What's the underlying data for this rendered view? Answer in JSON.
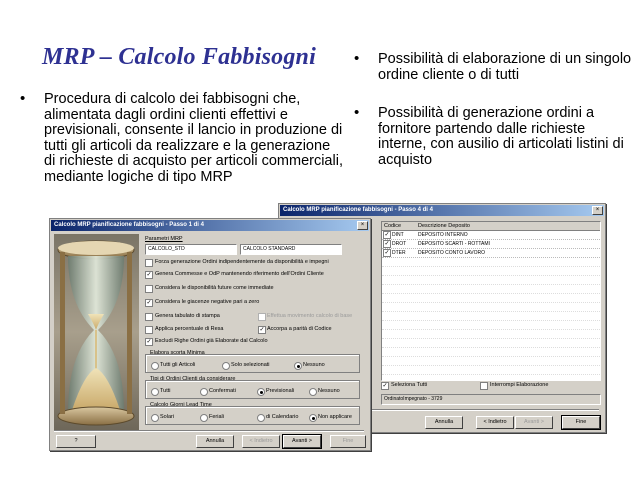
{
  "slide": {
    "title": "MRP – Calcolo Fabbisogni",
    "bullets_left": [
      "Procedura di calcolo dei fabbisogni che, alimentata dagli ordini clienti effettivi e previsionali, consente il lancio in produzione di tutti gli articoli da realizzare e la generazione di richieste di acquisto per articoli commerciali, mediante logiche di tipo MRP"
    ],
    "bullets_right": [
      "Possibilità di elaborazione di un singolo ordine cliente o di tutti",
      "Possibilità di generazione ordini a fornitore partendo dalle richieste interne, con ausilio di articolati listini di acquisto"
    ]
  },
  "dialog2": {
    "title": "Calcolo MRP pianificazione fabbisogni  -  Passo 4 di 4",
    "col_codice": "Codice",
    "col_descrizione": "Descrizione Deposito",
    "rows": [
      {
        "code": "DINT",
        "desc": "DEPOSITO INTERNO",
        "checked": true
      },
      {
        "code": "DROT",
        "desc": "DEPOSITO SCARTI - ROTTAMI",
        "checked": true
      },
      {
        "code": "DTER",
        "desc": "DEPOSITO CONTO LAVORO",
        "checked": true
      }
    ],
    "seleziona_tutti": "Seleziona Tutti",
    "interrompi": "Interrompi Elaborazione",
    "status": "OrdinatoImpegnato - 3729",
    "btn_annulla": "Annulla",
    "btn_indietro": "< Indietro",
    "btn_avanti": "Avanti >",
    "btn_fine": "Fine"
  },
  "dialog1": {
    "title": "Calcolo MRP pianificazione fabbisogni  -  Passo 1 di 4",
    "parametri_label": "Parametri MRP",
    "param_code": "CALCOLO_STD",
    "param_desc": "CALCOLO STANDARD",
    "options": [
      {
        "label": "Forza generazione Ordini indipendentemente da disponibilità e impegni",
        "checked": false
      },
      {
        "label": "Genera Commesse e OdP mantenendo riferimento dell'Ordini Cliente",
        "checked": true
      },
      {
        "label": "Considera le disponibilità future come immediate",
        "checked": false
      },
      {
        "label": "Considera le giacenze negative pari a zero",
        "checked": true
      }
    ],
    "genera_tabulato": "Genera tabulato di stampa",
    "effettua_movimento": "Effettua movimento calcolo di base",
    "applica_percentuale": "Applica percentuale di Resa",
    "accorpa": "Accorpa a parità di Codice",
    "escludi": "Escludi Righe Ordini già Elaborate dal Calcolo",
    "scorta_label": "Elabora scorta Minima",
    "scorta_options": [
      "Tutti gli Articoli",
      "Solo selezionati",
      "Nessuno"
    ],
    "tipi_label": "Tipi di Ordini Clienti da considerare",
    "tipi_options": [
      "Tutti",
      "Confermati",
      "Previsionali",
      "Nessuno"
    ],
    "giorni_label": "Calcolo Giorni Lead Time",
    "giorni_options": [
      "Solari",
      "Feriali",
      "di Calendario",
      "Non applicare"
    ],
    "btn_help": "?",
    "btn_annulla": "Annulla",
    "btn_indietro": "< Indietro",
    "btn_avanti": "Avanti >",
    "btn_fine": "Fine"
  }
}
